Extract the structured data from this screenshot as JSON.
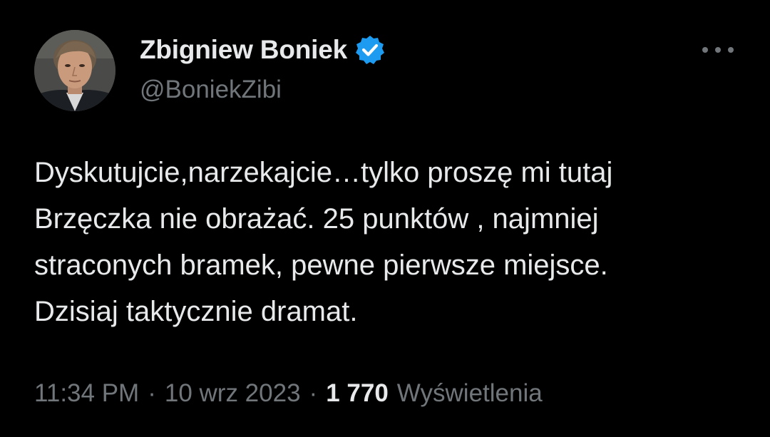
{
  "author": {
    "display_name": "Zbigniew Boniek",
    "handle": "@BoniekZibi",
    "verified": true,
    "verified_color": "#1d9bf0"
  },
  "icons": {
    "verified": "verified-badge-icon",
    "more": "more-options-icon"
  },
  "tweet": {
    "lines": [
      "Dyskutujcie,narzekajcie…tylko proszę mi tutaj",
      "Brzęczka nie obrażać. 25 punktów , najmniej",
      "straconych bramek, pewne pierwsze miejsce.",
      "Dzisiaj taktycznie dramat."
    ]
  },
  "meta": {
    "time": "11:34 PM",
    "separator": "·",
    "date": "10 wrz 2023",
    "views_count": "1 770",
    "views_label": "Wyświetlenia"
  },
  "colors": {
    "background": "#000000",
    "primary_text": "#e7e9ea",
    "secondary_text": "#71767b"
  }
}
